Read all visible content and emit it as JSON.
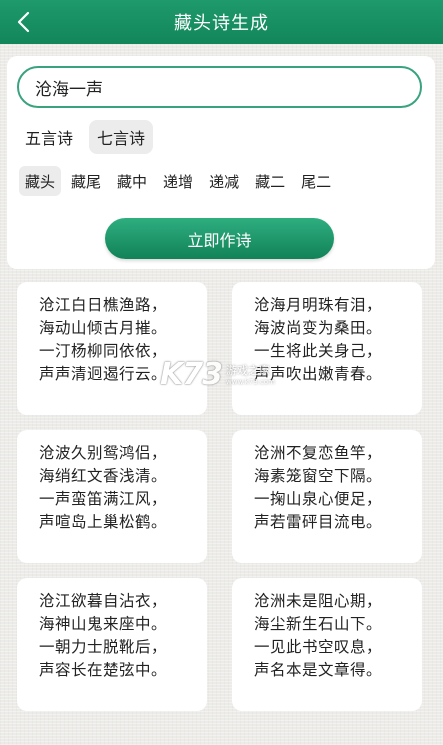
{
  "header": {
    "title": "藏头诗生成",
    "back_icon": "chevron-left-icon"
  },
  "input": {
    "value": "沧海一声"
  },
  "modes": [
    {
      "label": "五言诗",
      "active": false
    },
    {
      "label": "七言诗",
      "active": true
    }
  ],
  "types": [
    {
      "label": "藏头",
      "active": true
    },
    {
      "label": "藏尾",
      "active": false
    },
    {
      "label": "藏中",
      "active": false
    },
    {
      "label": "递增",
      "active": false
    },
    {
      "label": "递减",
      "active": false
    },
    {
      "label": "藏二",
      "active": false
    },
    {
      "label": "尾二",
      "active": false
    }
  ],
  "generate_label": "立即作诗",
  "poems": [
    {
      "lines": [
        "沧江白日樵渔路，",
        "海动山倾古月摧。",
        "一汀杨柳同依依，",
        "声声清迥遏行云。"
      ]
    },
    {
      "lines": [
        "沧海月明珠有泪，",
        "海波尚变为桑田。",
        "一生将此关身己，",
        "声声吹出嫩青春。"
      ]
    },
    {
      "lines": [
        "沧波久别鸳鸿侣，",
        "海绡红文香浅清。",
        "一声蛮笛满江风，",
        "声喧岛上巢松鹤。"
      ]
    },
    {
      "lines": [
        "沧洲不复恋鱼竿，",
        "海素笼窗空下隔。",
        "一掬山泉心便足，",
        "声若雷砰目流电。"
      ]
    },
    {
      "lines": [
        "沧江欲暮自沾衣，",
        "海神山鬼来座中。",
        "一朝力士脱靴后，",
        "声容长在楚弦中。"
      ]
    },
    {
      "lines": [
        "沧洲未是阻心期，",
        "海尘新生石山下。",
        "一见此书空叹息，",
        "声名本是文章得。"
      ]
    }
  ],
  "watermark": {
    "logo": "K73",
    "cn": "游戏之家",
    "en": "www.k73.com"
  },
  "colors": {
    "primary": "#1a9467",
    "accent_border": "#3aa37e"
  }
}
